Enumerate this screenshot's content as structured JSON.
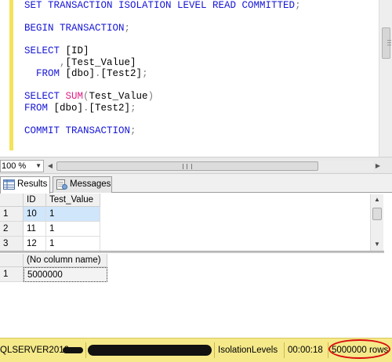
{
  "editor": {
    "lines": [
      {
        "tokens": [
          {
            "t": "SET TRANSACTION ISOLATION LEVEL READ COMMITTED",
            "c": "kw"
          },
          {
            "t": ";",
            "c": "gr"
          }
        ]
      },
      {
        "tokens": []
      },
      {
        "tokens": [
          {
            "t": "BEGIN TRANSACTION",
            "c": "kw"
          },
          {
            "t": ";",
            "c": "gr"
          }
        ]
      },
      {
        "tokens": []
      },
      {
        "tokens": [
          {
            "t": "SELECT ",
            "c": "kw"
          },
          {
            "t": "[ID]",
            "c": "tx"
          }
        ]
      },
      {
        "tokens": [
          {
            "t": "      ,",
            "c": "gr"
          },
          {
            "t": "[Test_Value]",
            "c": "tx"
          }
        ]
      },
      {
        "tokens": [
          {
            "t": "  FROM ",
            "c": "kw"
          },
          {
            "t": "[dbo]",
            "c": "tx"
          },
          {
            "t": ".",
            "c": "gr"
          },
          {
            "t": "[Test2]",
            "c": "tx"
          },
          {
            "t": ";",
            "c": "gr"
          }
        ]
      },
      {
        "tokens": []
      },
      {
        "tokens": [
          {
            "t": "SELECT ",
            "c": "kw"
          },
          {
            "t": "SUM",
            "c": "fn"
          },
          {
            "t": "(",
            "c": "gr"
          },
          {
            "t": "Test_Value",
            "c": "tx"
          },
          {
            "t": ")",
            "c": "gr"
          }
        ]
      },
      {
        "tokens": [
          {
            "t": "FROM ",
            "c": "kw"
          },
          {
            "t": "[dbo]",
            "c": "tx"
          },
          {
            "t": ".",
            "c": "gr"
          },
          {
            "t": "[Test2]",
            "c": "tx"
          },
          {
            "t": ";",
            "c": "gr"
          }
        ]
      },
      {
        "tokens": []
      },
      {
        "tokens": [
          {
            "t": "COMMIT TRANSACTION",
            "c": "kw"
          },
          {
            "t": ";",
            "c": "gr"
          }
        ]
      }
    ]
  },
  "zoom": {
    "value": "100 %"
  },
  "tabs": {
    "results": {
      "label": "Results",
      "icon": "grid-icon"
    },
    "messages": {
      "label": "Messages",
      "icon": "messages-icon"
    }
  },
  "grid1": {
    "columns": [
      "ID",
      "Test_Value"
    ],
    "rows": [
      {
        "num": "1",
        "cells": [
          "10",
          "1"
        ]
      },
      {
        "num": "2",
        "cells": [
          "11",
          "1"
        ]
      },
      {
        "num": "3",
        "cells": [
          "12",
          "1"
        ]
      }
    ]
  },
  "grid2": {
    "columns": [
      "(No column name)"
    ],
    "rows": [
      {
        "num": "1",
        "cells": [
          "5000000"
        ]
      }
    ]
  },
  "status": {
    "server": "QLSERVER2012",
    "database": "IsolationLevels",
    "elapsed": "00:00:18",
    "rows": "5000000 rows"
  },
  "colors": {
    "keyword": "#1515d6",
    "function": "#e01b84",
    "status_bar": "#f5e98a",
    "highlight_oval": "#d90d0d"
  }
}
